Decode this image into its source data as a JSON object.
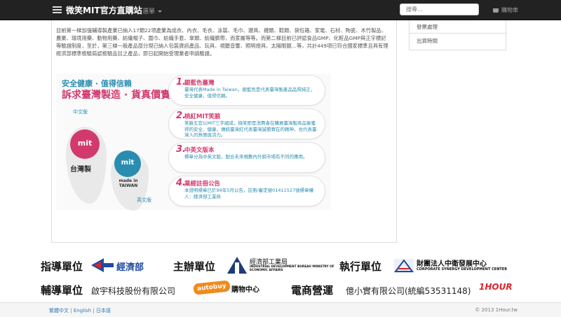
{
  "navbar": {
    "brand": "微笑MIT官方直購站",
    "menu_label": "選單",
    "search_placeholder": "搜尋...",
    "cart_label": "購物車"
  },
  "sidebar": {
    "items": [
      {
        "label": "發票處理"
      },
      {
        "label": "出貨時間"
      }
    ]
  },
  "intro_text": "目前第一梯加強輔導製產業已納入17類22項產業為成衣、內衣、毛衣、泳裝、毛巾、寢具、襪類、鞋類、袋包箱、家電、石材、陶瓷、木竹製品、農業、環境用藥、動物用藥、紡織帽子、圍巾、紡織手套、傘類、紡織臍帶，而家屬等等。而第二梯目前已評認食品GMP、化粧品GMP與正字標記等驗證制度，至於，第三梯一般產品部分現已納入包裝資訊產品、玩具、視聽音響、照明燈具、太陽眼鏡…等，共計449項已符合國家標準且具有理經濟部標準檢驗局認檢驗品目之產品，即日起開始受理業者申請驗證。",
  "graphic": {
    "slogan_line1": "安全健康 · 值得信賴",
    "slogan_line2": "訴求臺灣製造 · 貨真價實",
    "label_chinese": "中文版",
    "label_english": "英文版",
    "mit_text": "mit",
    "caption_made_in_tw": "台灣製",
    "caption_made_in_taiwan": "made in TAIWAN",
    "items": [
      {
        "num": "1.",
        "title": "銀藍色臺灣",
        "body": "臺灣代表Made in Taiwan，銀藍色是代表臺灣製產品品質純正，安全健康，值得信賴。"
      },
      {
        "num": "2.",
        "title": "桃紅MIT笑臉",
        "body": "笑臉五官以MIT三字組成，微笑即是消費者在購買臺灣製商品後獲得的安全、健康，傳統臺灣紅代表臺灣誠懇實在的精神，也代表臺灣人的熱情與活力。"
      },
      {
        "num": "3.",
        "title": "中英文版本",
        "body": "標章分為中英文版，配合未來規劃內外銷市場有不同的應用。"
      },
      {
        "num": "4.",
        "title": "業經註冊公告",
        "body": "本證明標章已於99年5月公告，註冊/審定號01411527號標章權人：經濟部工業局"
      }
    ]
  },
  "sponsors": {
    "guide_heading": "指導單位",
    "guide_org": "經濟部",
    "host_heading": "主辦單位",
    "host_org_cn": "經濟部工業局",
    "host_org_en": "INDUSTRIAL DEVELOPMENT BUREAU MINISTRY OF ECONOMIC AFFAIRS",
    "exec_heading": "執行單位",
    "exec_org_cn": "財團法人中衛發展中心",
    "exec_org_en": "CORPORATE SYNERGY DEVELOPMENT CENTER",
    "assist_heading": "輔導單位",
    "assist_org": "啟宇科技股份有限公司",
    "autobuy_logo": "autobuy",
    "autobuy_name": "購物中心",
    "ecom_heading": "電商營運",
    "ecom_org": "億小實有限公司(統編53531148)",
    "onehour_logo": "1HOUR"
  },
  "footer": {
    "lang_zh": "繁體中文",
    "lang_en": "English",
    "lang_ja": "日本語",
    "copyright": "© 2013 1Hour.tw"
  },
  "colors": {
    "brand_blue": "#2a8db0",
    "brand_pink": "#d23a6e",
    "navbar_bg": "#222222"
  }
}
